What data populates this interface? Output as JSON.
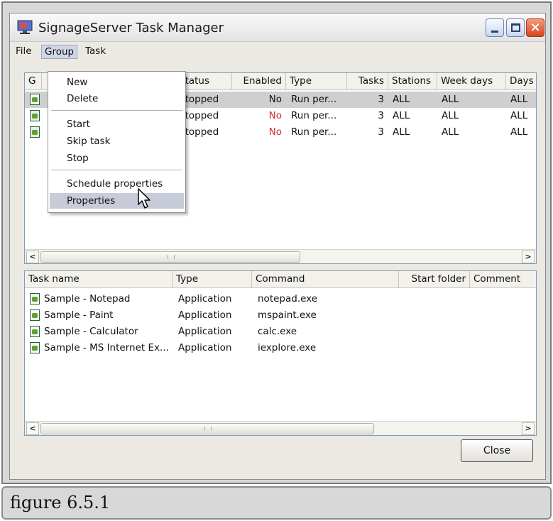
{
  "window": {
    "title": "SignageServer Task Manager",
    "buttons": {
      "minimize": "minimize",
      "maximize": "maximize",
      "close": "×"
    }
  },
  "menubar": {
    "file": "File",
    "group": "Group",
    "task": "Task"
  },
  "group_menu": {
    "items": [
      "New",
      "Delete",
      "Start",
      "Skip task",
      "Stop",
      "Schedule properties",
      "Properties"
    ],
    "highlighted": "Properties"
  },
  "groups_table": {
    "headers": {
      "group": "G",
      "status": "Status",
      "enabled": "Enabled",
      "type": "Type",
      "tasks": "Tasks",
      "stations": "Stations",
      "week_days": "Week days",
      "days": "Days"
    },
    "rows": [
      {
        "status": "Stopped",
        "enabled": "No",
        "type": "Run per...",
        "tasks": "3",
        "stations": "ALL",
        "week_days": "ALL",
        "days": "ALL",
        "selected": true
      },
      {
        "status": "Stopped",
        "enabled": "No",
        "type": "Run per...",
        "tasks": "3",
        "stations": "ALL",
        "week_days": "ALL",
        "days": "ALL",
        "selected": false
      },
      {
        "status": "Stopped",
        "enabled": "No",
        "type": "Run per...",
        "tasks": "3",
        "stations": "ALL",
        "week_days": "ALL",
        "days": "ALL",
        "selected": false
      }
    ]
  },
  "tasks_table": {
    "headers": {
      "task_name": "Task name",
      "type": "Type",
      "command": "Command",
      "start_folder": "Start folder",
      "comment": "Comment"
    },
    "rows": [
      {
        "task_name": "Sample - Notepad",
        "type": "Application",
        "command": "notepad.exe"
      },
      {
        "task_name": "Sample - Paint",
        "type": "Application",
        "command": "mspaint.exe"
      },
      {
        "task_name": "Sample - Calculator",
        "type": "Application",
        "command": "calc.exe"
      },
      {
        "task_name": "Sample - MS Internet Ex...",
        "type": "Application",
        "command": "iexplore.exe"
      }
    ]
  },
  "scroll_arrows": {
    "left": "<",
    "right": ">"
  },
  "close_button": "Close",
  "caption": "figure 6.5.1",
  "colors": {
    "disabled_red": "#d42a2a",
    "selection": "#cfcfd1",
    "menu_highlight": "#c8ccd8"
  }
}
